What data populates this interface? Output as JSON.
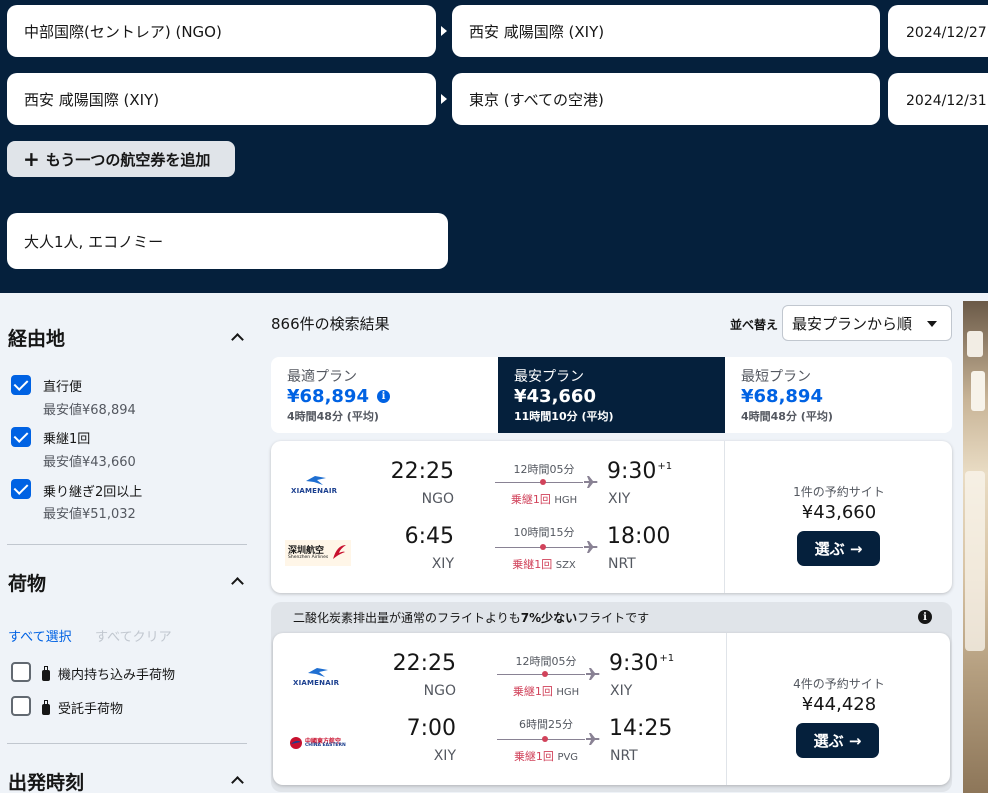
{
  "search": {
    "rows": [
      {
        "origin": "中部国際(セントレア) (NGO)",
        "destination": "西安 咸陽国際 (XIY)",
        "date": "2024/12/27"
      },
      {
        "origin": "西安 咸陽国際 (XIY)",
        "destination": "東京 (すべての空港)",
        "date": "2024/12/31"
      }
    ],
    "add_flight_label": "もう一つの航空券を追加",
    "passengers": "大人1人, エコノミー"
  },
  "filters": {
    "stops": {
      "title": "経由地",
      "options": [
        {
          "label": "直行便",
          "sub": "最安値¥68,894",
          "checked": true
        },
        {
          "label": "乗継1回",
          "sub": "最安値¥43,660",
          "checked": true
        },
        {
          "label": "乗り継ぎ2回以上",
          "sub": "最安値¥51,032",
          "checked": true
        }
      ]
    },
    "baggage": {
      "title": "荷物",
      "select_all": "すべて選択",
      "clear_all": "すべてクリア",
      "options": [
        {
          "label": "機内持ち込み手荷物",
          "checked": false
        },
        {
          "label": "受託手荷物",
          "checked": false
        }
      ]
    },
    "departure": {
      "title": "出発時刻"
    }
  },
  "results": {
    "count": "866件の検索結果",
    "sort_label": "並べ替え",
    "sort_value": "最安プランから順"
  },
  "tabs": [
    {
      "name": "最適プラン",
      "price": "¥68,894",
      "duration": "4時間48分 (平均)",
      "active": false,
      "info": true
    },
    {
      "name": "最安プラン",
      "price": "¥43,660",
      "duration": "11時間10分 (平均)",
      "active": true,
      "info": false
    },
    {
      "name": "最短プラン",
      "price": "¥68,894",
      "duration": "4時間48分 (平均)",
      "active": false,
      "info": false
    }
  ],
  "eco_banner": {
    "pre": "二酸化炭素排出量が通常のフライトよりも",
    "pct": "7%少ない",
    "post": "フライトです"
  },
  "cards": [
    {
      "legs": [
        {
          "airline": "XIAMENAIR",
          "dep_time": "22:25",
          "dep_code": "NGO",
          "duration": "12時間05分",
          "stops": "乗継1回",
          "via": "HGH",
          "arr_time": "9:30",
          "arr_plus": "+1",
          "arr_code": "XIY"
        },
        {
          "airline": "深圳航空",
          "airline_sub": "Shenzhen Airlines",
          "dep_time": "6:45",
          "dep_code": "XIY",
          "duration": "10時間15分",
          "stops": "乗継1回",
          "via": "SZX",
          "arr_time": "18:00",
          "arr_plus": "",
          "arr_code": "NRT"
        }
      ],
      "sites": "1件の予約サイト",
      "price": "¥43,660",
      "select": "選ぶ →"
    },
    {
      "legs": [
        {
          "airline": "XIAMENAIR",
          "dep_time": "22:25",
          "dep_code": "NGO",
          "duration": "12時間05分",
          "stops": "乗継1回",
          "via": "HGH",
          "arr_time": "9:30",
          "arr_plus": "+1",
          "arr_code": "XIY"
        },
        {
          "airline": "中國東方航空",
          "airline_sub": "CHINA EASTERN",
          "dep_time": "7:00",
          "dep_code": "XIY",
          "duration": "6時間25分",
          "stops": "乗継1回",
          "via": "PVG",
          "arr_time": "14:25",
          "arr_plus": "",
          "arr_code": "NRT"
        }
      ],
      "sites": "4件の予約サイト",
      "price": "¥44,428",
      "select": "選ぶ →"
    }
  ],
  "colors": {
    "navy": "#05203c",
    "blue": "#0062e3",
    "stop_red": "#d1435b"
  }
}
